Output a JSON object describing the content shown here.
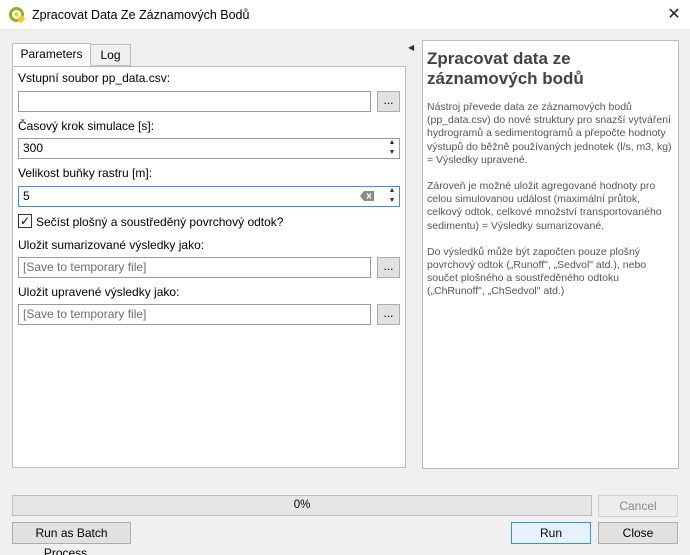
{
  "window": {
    "title": "Zpracovat Data Ze Záznamových Bodů",
    "close_glyph": "✕"
  },
  "tabs": {
    "parameters": "Parameters",
    "log": "Log"
  },
  "form": {
    "input_label": "Vstupní soubor pp_data.csv:",
    "input_value": "",
    "browse_label": "...",
    "time_step_label": "Časový krok simulace [s]:",
    "time_step_value": "300",
    "cell_size_label": "Velikost buňky rastru [m]:",
    "cell_size_value": "5",
    "checkbox_checked": true,
    "checkbox_mark": "✓",
    "checkbox_label": "Sečíst plošný a soustředěný povrchový odtok?",
    "summary_label": "Uložit sumarizované výsledky jako:",
    "summary_placeholder": "[Save to temporary file]",
    "adjusted_label": "Uložit upravené výsledky jako:",
    "adjusted_placeholder": "[Save to temporary file]",
    "browse_menu_label": "..."
  },
  "help": {
    "title": "Zpracovat data ze záznamových bodů",
    "paragraphs": [
      "Nástroj převede data ze záznamových bodů (pp_data.csv) do nové struktury pro snazší vytváření hydrogramů a sedimentogramů a přepočte hodnoty výstupů do běžně používaných jednotek (l/s, m3, kg) = Výsledky upravené.",
      "Zároveň je možné uložit agregované hodnoty pro celou simulovanou událost (maximální průtok, celkový odtok, celkové množství transportovaného sedimentu) = Výsledky sumarizované.",
      "Do výsledků může být započten pouze plošný povrchový odtok („Runoff\", „Sedvol\" atd.), nebo součet plošného a soustředěného odtoku („ChRunoff\", „ChSedvol\" atd.)"
    ]
  },
  "footer": {
    "progress_value": 0,
    "progress_text": "0%",
    "cancel_label": "Cancel",
    "batch_label": "Run as Batch Process…",
    "run_label": "Run",
    "close_label": "Close"
  },
  "colors": {
    "qgis_green": "#93b023",
    "qgis_yellow": "#eec641",
    "focus_blue": "#3c8fd8"
  },
  "icons": {
    "app": "qgis-logo-icon",
    "close": "close-icon",
    "clear": "clear-backspace-icon",
    "spin_up": "spin-up-icon",
    "spin_down": "spin-down-icon",
    "splitter": "collapse-arrow-icon"
  }
}
